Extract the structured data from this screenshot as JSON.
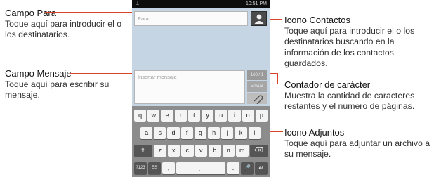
{
  "phone": {
    "status_time": "10:51 PM",
    "to_placeholder": "Para",
    "message_placeholder": "Insertar mensaje",
    "counter": "160 / 1",
    "send_label": "Enviar",
    "keyboard": {
      "row1": [
        "q",
        "w",
        "e",
        "r",
        "t",
        "y",
        "u",
        "i",
        "o",
        "p"
      ],
      "row2": [
        "a",
        "s",
        "d",
        "f",
        "g",
        "h",
        "j",
        "k",
        "l"
      ],
      "row3": [
        "z",
        "x",
        "c",
        "v",
        "b",
        "n",
        "m"
      ],
      "sym_key": "?123",
      "lang_key": "ES",
      "comma": ",",
      "period": "."
    }
  },
  "callouts": {
    "campo_para": {
      "title": "Campo Para",
      "desc": "Toque aquí para introducir el o los destinatarios."
    },
    "campo_mensaje": {
      "title": "Campo Mensaje",
      "desc": "Toque aquí para escribir su mensaje."
    },
    "icono_contactos": {
      "title": "Icono Contactos",
      "desc": "Toque aquí para introducir el o los destinatarios buscando en la información de los contactos guardados."
    },
    "contador": {
      "title": "Contador de carácter",
      "desc": "Muestra la cantidad de caracteres restantes y el número de páginas."
    },
    "icono_adjuntos": {
      "title": "Icono Adjuntos",
      "desc": "Toque aquí para adjuntar un archivo a su mensaje."
    }
  },
  "colors": {
    "callout_line": "#d8432a",
    "screen_bg": "#c6d5e4",
    "keyboard_bg": "#8c8c8c"
  }
}
